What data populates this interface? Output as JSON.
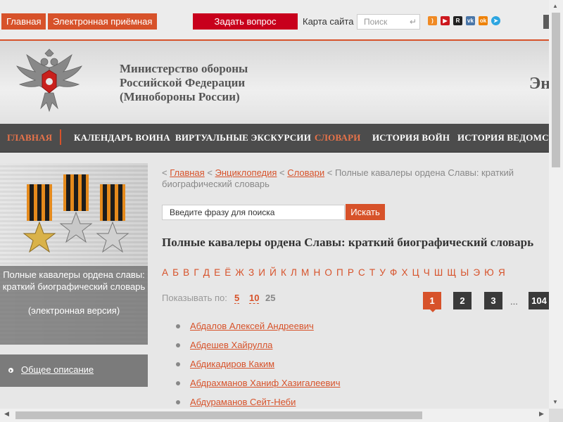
{
  "topbar": {
    "home": "Главная",
    "reception": "Электронная приёмная",
    "ask": "Задать вопрос",
    "sitemap": "Карта сайта",
    "search_placeholder": "Поиск",
    "social": [
      "rss-icon",
      "youtube-icon",
      "rutube-icon",
      "vk-icon",
      "odnoklassniki-icon",
      "telegram-icon"
    ]
  },
  "header": {
    "ministry_line1": "Министерство обороны",
    "ministry_line2": "Российской Федерации",
    "ministry_line3": "(Минобороны России)",
    "cut_text": "Эн"
  },
  "nav": {
    "items": [
      "Главная",
      "Календарь воина",
      "Виртуальные экскурсии",
      "Словари",
      "История войн",
      "История ведомств"
    ]
  },
  "sidebar": {
    "caption": "Полные кавалеры ордена славы: краткий биографический словарь",
    "caption_sub": "(электронная версия)",
    "link": "Общее описание"
  },
  "breadcrumb": {
    "home": "Главная",
    "encyclopedia": "Энциклопедия",
    "dictionaries": "Словари",
    "current": "Полные кавалеры ордена Славы: краткий биографический словарь"
  },
  "search": {
    "placeholder": "Введите фразу для поиска",
    "button": "Искать"
  },
  "title": "Полные кавалеры ордена Славы: краткий биографический словарь",
  "alphabet": {
    "active": "А Б В Г Д Е Ё Ж З И Й К Л М Н О П Р С Т У Ф Х Ц Ч Ш Щ Ы Э Ю Я"
  },
  "pagination": {
    "show_label": "Показывать по:",
    "per_page": [
      "5",
      "10",
      "25"
    ],
    "pages": [
      "1",
      "2",
      "3"
    ],
    "ellipsis": "...",
    "last": "104",
    "current": "1"
  },
  "entries": [
    "Абдалов Алексей Андреевич",
    "Абдешев Хайрулла",
    "Абдикадиров Каким",
    "Абдрахманов Ханиф Хазигалеевич",
    "Абдураманов Сейт-Неби"
  ],
  "colors": {
    "accent": "#d7522a",
    "ask_button": "#c8001c",
    "nav_bg": "#4c4c4c"
  }
}
